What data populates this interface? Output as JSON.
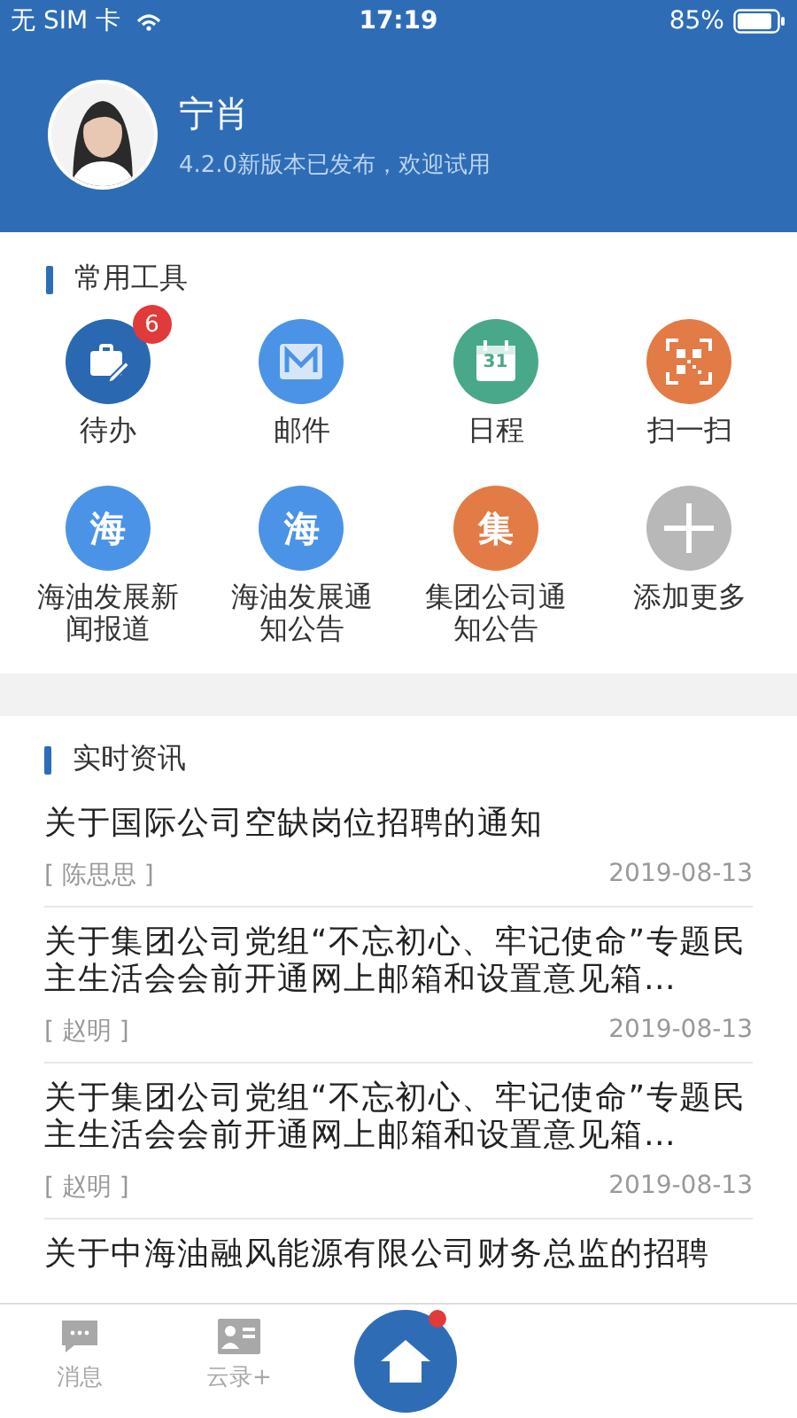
{
  "status_bar": {
    "carrier": "无 SIM 卡",
    "time": "17:19",
    "battery": "85%"
  },
  "profile": {
    "name": "宁肖",
    "message": "4.2.0新版本已发布，欢迎试用"
  },
  "tools": {
    "title": "常用工具",
    "items": [
      {
        "kind": "todo",
        "label": "待办",
        "color": "#2a68b2",
        "badge": "6"
      },
      {
        "kind": "mail",
        "label": "邮件",
        "color": "#4b93e6"
      },
      {
        "kind": "calendar",
        "label": "日程",
        "color": "#4aa88a",
        "icon_text": "31"
      },
      {
        "kind": "scan",
        "label": "扫一扫",
        "color": "#e27b45"
      },
      {
        "kind": "glyph",
        "label": "海油发展新闻报道",
        "color": "#4b93e6",
        "icon_text": "海"
      },
      {
        "kind": "glyph",
        "label": "海油发展通知公告",
        "color": "#4b93e6",
        "icon_text": "海"
      },
      {
        "kind": "glyph",
        "label": "集团公司通知公告",
        "color": "#e27b45",
        "icon_text": "集"
      },
      {
        "kind": "add",
        "label": "添加更多",
        "color": "#b8b8b8"
      }
    ]
  },
  "news": {
    "title": "实时资讯",
    "items": [
      {
        "title": "关于国际公司空缺岗位招聘的通知",
        "author": "[ 陈思思 ]",
        "date": "2019-08-13"
      },
      {
        "title": "关于集团公司党组“不忘初心、牢记使命”专题民主生活会会前开通网上邮箱和设置意见箱…",
        "author": "[ 赵明 ]",
        "date": "2019-08-13"
      },
      {
        "title": "关于集团公司党组“不忘初心、牢记使命”专题民主生活会会前开通网上邮箱和设置意见箱…",
        "author": "[ 赵明 ]",
        "date": "2019-08-13"
      },
      {
        "title": "关于中海油融风能源有限公司财务总监的招聘"
      }
    ]
  },
  "tab_bar": {
    "items": [
      {
        "kind": "chat",
        "label": "消息",
        "selected": false
      },
      {
        "kind": "contact",
        "label": "云录+",
        "selected": false
      },
      {
        "kind": "home",
        "selected": true,
        "dot": true
      }
    ]
  }
}
